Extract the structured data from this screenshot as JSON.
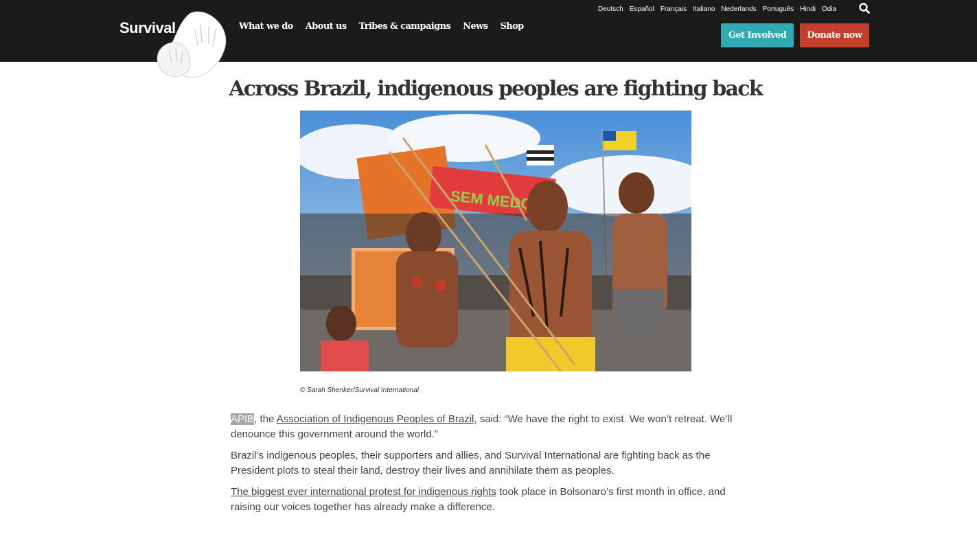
{
  "brand": {
    "name": "Survival"
  },
  "nav": {
    "main": [
      "What we do",
      "About us",
      "Tribes & campaigns",
      "News",
      "Shop"
    ],
    "languages": [
      "Deutsch",
      "Español",
      "Français",
      "Italiano",
      "Nederlands",
      "Português",
      "Hindi",
      "Odia"
    ],
    "search_icon": "search-icon",
    "get_involved": "Get Involved",
    "donate": "Donate now"
  },
  "colors": {
    "header_bg": "#1b1b1b",
    "get_involved": "#30a9b3",
    "donate": "#c2402b"
  },
  "article": {
    "title": "Across Brazil, indigenous peoples are fighting back",
    "image_caption": "© Sarah Shenker/Survival International",
    "p1": {
      "acronym": "APIB",
      "text_a": ", the ",
      "link": "Association of Indigenous Peoples of Brazil",
      "text_b": ", said: “We have the right to exist. We won’t retreat. We’ll denounce this government around the world.”"
    },
    "p2": "Brazil’s indigenous peoples, their supporters and allies, and Survival International are fighting back as the President plots to steal their land, destroy their lives and annihilate them as peoples.",
    "p3": {
      "link": "The biggest ever international protest for indigenous rights",
      "text": " took place in Bolsonaro’s first month in office, and raising our voices together has already make a difference."
    }
  }
}
